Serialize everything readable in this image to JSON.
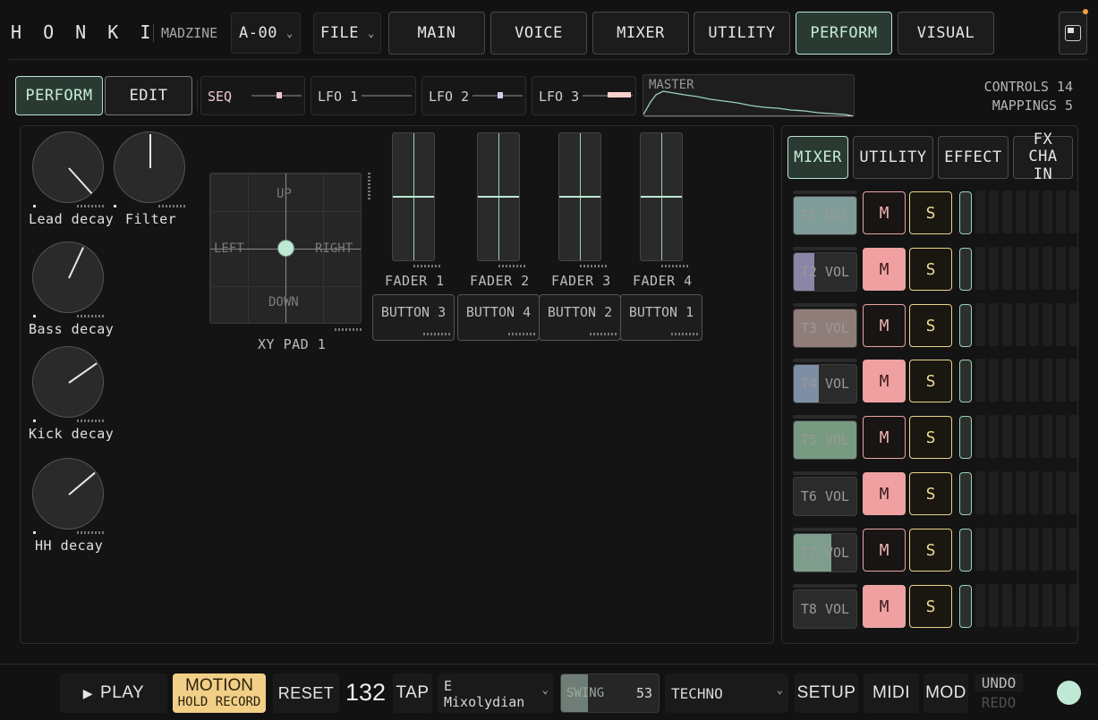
{
  "brand": {
    "logo": "H O N K I",
    "user": "MADZINE"
  },
  "preset": {
    "value": "A-00"
  },
  "file_menu": {
    "label": "FILE"
  },
  "top_tabs": [
    "MAIN",
    "VOICE",
    "MIXER",
    "UTILITY",
    "PERFORM",
    "VISUAL"
  ],
  "active_top_tab": "PERFORM",
  "mode_tabs": [
    "PERFORM",
    "EDIT"
  ],
  "mods": [
    {
      "label": "SEQ",
      "accent": "#f0c6d8"
    },
    {
      "label": "LFO 1",
      "accent": "#9a9a9a"
    },
    {
      "label": "LFO 2",
      "accent": "#d8c8f0"
    },
    {
      "label": "LFO 3",
      "accent": "#f7d1cd"
    }
  ],
  "master": {
    "label": "MASTER"
  },
  "controls_info": {
    "controls": "CONTROLS 14",
    "mappings": "MAPPINGS 5"
  },
  "knobs": [
    {
      "label": "Lead decay",
      "angle": -42
    },
    {
      "label": "Filter",
      "angle": 180
    },
    {
      "label": "Bass decay",
      "angle": 205
    },
    {
      "label": "Kick decay",
      "angle": 235
    },
    {
      "label": "HH decay",
      "angle": 230
    }
  ],
  "xy_pad": {
    "label": "XY PAD 1",
    "up": "UP",
    "down": "DOWN",
    "left": "LEFT",
    "right": "RIGHT"
  },
  "faders": [
    {
      "label": "FADER 1",
      "value": 0.5
    },
    {
      "label": "FADER 2",
      "value": 0.5
    },
    {
      "label": "FADER 3",
      "value": 0.5
    },
    {
      "label": "FADER 4",
      "value": 0.5
    }
  ],
  "pad_buttons": [
    "BUTTON 3",
    "BUTTON 4",
    "BUTTON 2",
    "BUTTON 1"
  ],
  "right_tabs": [
    "MIXER",
    "UTILITY",
    "EFFECT",
    "FX CHAIN"
  ],
  "tracks": [
    {
      "label": "T1 VOL",
      "level": 1.0,
      "color": "#7f9c98",
      "mute": false
    },
    {
      "label": "T2 VOL",
      "level": 0.33,
      "color": "#8a86a8",
      "mute": true
    },
    {
      "label": "T3 VOL",
      "level": 1.0,
      "color": "#8f7d79",
      "mute": false
    },
    {
      "label": "T4 VOL",
      "level": 0.4,
      "color": "#7e8fa3",
      "mute": true
    },
    {
      "label": "T5 VOL",
      "level": 1.0,
      "color": "#789a81",
      "mute": false
    },
    {
      "label": "T6 VOL",
      "level": 0.0,
      "color": "#7a7a7a",
      "mute": true
    },
    {
      "label": "T7 VOL",
      "level": 0.6,
      "color": "#7f9d8d",
      "mute": false
    },
    {
      "label": "T8 VOL",
      "level": 0.0,
      "color": "#7a7a7a",
      "mute": true
    }
  ],
  "mute_label": "M",
  "solo_label": "S",
  "bottom": {
    "play": "PLAY",
    "motion": "MOTION",
    "motion_sub": "HOLD RECORD",
    "reset": "RESET",
    "bpm": "132",
    "tap": "TAP",
    "scale_line1": "E",
    "scale_line2": "Mixolydian",
    "swing_label": "SWING",
    "swing_value": "53",
    "swing_level": 0.53,
    "style": "TECHNO",
    "setup": "SETUP",
    "midi": "MIDI",
    "mod": "MOD",
    "undo": "UNDO",
    "redo": "REDO"
  },
  "colors": {
    "accent": "#bfe9d4",
    "mute": "#f0a0a0",
    "solo": "#f0dc93"
  }
}
